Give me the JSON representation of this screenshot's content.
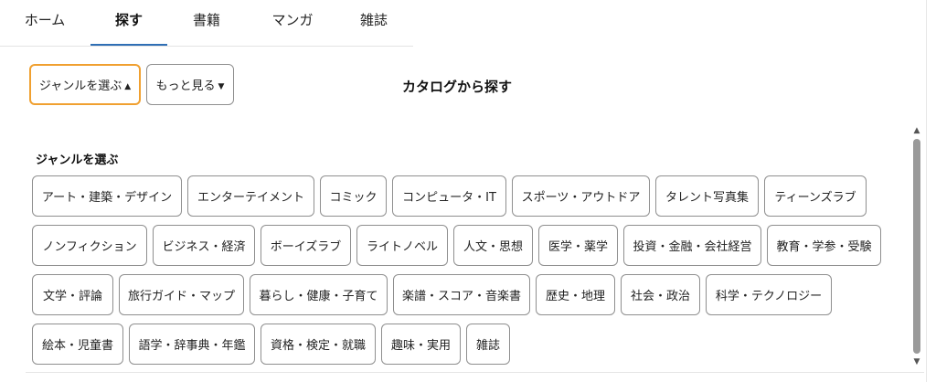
{
  "tabs": [
    {
      "label": "ホーム"
    },
    {
      "label": "探す"
    },
    {
      "label": "書籍"
    },
    {
      "label": "マンガ"
    },
    {
      "label": "雑誌"
    }
  ],
  "active_tab": "探す",
  "filters": {
    "genre_label": "ジャンルを選ぶ",
    "more_label": "もっと見る",
    "caret": "▲"
  },
  "page_title": "カタログから探す",
  "section_title": "ジャンルを選ぶ",
  "genres": [
    "アート・建築・デザイン",
    "エンターテイメント",
    "コミック",
    "コンピュータ・IT",
    "スポーツ・アウトドア",
    "タレント写真集",
    "ティーンズラブ",
    "ノンフィクション",
    "ビジネス・経済",
    "ボーイズラブ",
    "ライトノベル",
    "人文・思想",
    "医学・薬学",
    "投資・金融・会社経営",
    "教育・学参・受験",
    "文学・評論",
    "旅行ガイド・マップ",
    "暮らし・健康・子育て",
    "楽譜・スコア・音楽書",
    "歴史・地理",
    "社会・政治",
    "科学・テクノロジー",
    "絵本・児童書",
    "語学・辞事典・年鑑",
    "資格・検定・就職",
    "趣味・実用",
    "雑誌"
  ]
}
